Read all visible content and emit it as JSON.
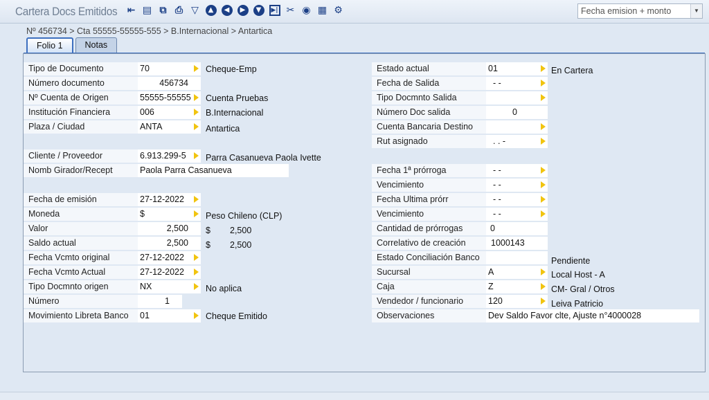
{
  "app": {
    "title": "Cartera Docs Emitidos"
  },
  "toolbar": {
    "icons": [
      "back-arrow-icon",
      "save-icon",
      "copy-icon",
      "print-icon",
      "delete-icon",
      "arrow-up-icon",
      "arrow-left-icon",
      "arrow-right-icon",
      "arrow-down-icon",
      "last-record-icon",
      "tools-icon",
      "view-icon",
      "calculator-icon",
      "settings-icon"
    ]
  },
  "sort": {
    "selected": "Fecha emision + monto"
  },
  "breadcrumb": "Nº 456734 > Cta 55555-55555-555 > B.Internacional > Antartica",
  "tabs": [
    {
      "label": "Folio 1"
    },
    {
      "label": "Notas"
    }
  ],
  "left": {
    "tipo_doc": {
      "label": "Tipo de Documento",
      "value": "70",
      "desc": "Cheque-Emp"
    },
    "numero_doc": {
      "label": "Número documento",
      "value": "456734"
    },
    "cuenta_origen": {
      "label": "Nº Cuenta de Origen",
      "value": "55555-55555",
      "desc": "Cuenta Pruebas"
    },
    "institucion": {
      "label": "Institución Financiera",
      "value": "006",
      "desc": "B.Internacional"
    },
    "plaza": {
      "label": "Plaza / Ciudad",
      "value": "ANTA",
      "desc": "Antartica"
    },
    "cliente": {
      "label": "Cliente / Proveedor",
      "value": "6.913.299-5",
      "desc": "Parra Casanueva Paola Ivette"
    },
    "girador": {
      "label": "Nomb Girador/Recept",
      "value": "Paola Parra Casanueva"
    },
    "fecha_emision": {
      "label": "Fecha de emisión",
      "value": "27-12-2022"
    },
    "moneda": {
      "label": "Moneda",
      "value": "$",
      "desc": "Peso Chileno (CLP)"
    },
    "valor": {
      "label": "Valor",
      "value": "2,500",
      "cur": "$",
      "amount": "2,500"
    },
    "saldo": {
      "label": "Saldo actual",
      "value": "2,500",
      "cur": "$",
      "amount": "2,500"
    },
    "vcmto_orig": {
      "label": "Fecha Vcmto original",
      "value": "27-12-2022"
    },
    "vcmto_act": {
      "label": "Fecha Vcmto Actual",
      "value": "27-12-2022"
    },
    "tipo_origen": {
      "label": "Tipo Docmnto origen",
      "value": "NX",
      "desc": "No aplica"
    },
    "numero": {
      "label": "Número",
      "value": "1"
    },
    "mov_libreta": {
      "label": "Movimiento Libreta Banco",
      "value": "01",
      "desc": "Cheque Emitido"
    }
  },
  "right": {
    "estado": {
      "label": "Estado actual",
      "value": "01",
      "desc": "En Cartera"
    },
    "fecha_salida": {
      "label": "Fecha de Salida",
      "value": "- -"
    },
    "tipo_salida": {
      "label": "Tipo Docmnto Salida",
      "value": ""
    },
    "num_salida": {
      "label": "Número Doc salida",
      "value": "0"
    },
    "cta_destino": {
      "label": "Cuenta Bancaria Destino",
      "value": ""
    },
    "rut": {
      "label": "Rut asignado",
      "value": ". . -"
    },
    "prorroga1": {
      "label": "Fecha 1ª prórroga",
      "value": "- -"
    },
    "venc1": {
      "label": "Vencimiento",
      "value": "- -"
    },
    "prorroga_ult": {
      "label": "Fecha Ultima prórr",
      "value": "- -"
    },
    "venc2": {
      "label": "Vencimiento",
      "value": "- -"
    },
    "cant_prorrogas": {
      "label": "Cantidad de prórrogas",
      "value": "0"
    },
    "correlativo": {
      "label": "Correlativo de creación",
      "value": "1000143"
    },
    "conciliacion": {
      "label": "Estado Conciliación Banco",
      "value": "",
      "desc": "Pendiente"
    },
    "sucursal": {
      "label": "Sucursal",
      "value": "A",
      "desc": "Local Host - A"
    },
    "caja": {
      "label": "Caja",
      "value": "Z",
      "desc": "CM- Gral / Otros"
    },
    "vendedor": {
      "label": "Vendedor / funcionario",
      "value": "120",
      "desc": "Leiva Patricio"
    },
    "observaciones": {
      "label": "Observaciones",
      "value": "Dev Saldo Favor clte, Ajuste n°4000028"
    }
  }
}
